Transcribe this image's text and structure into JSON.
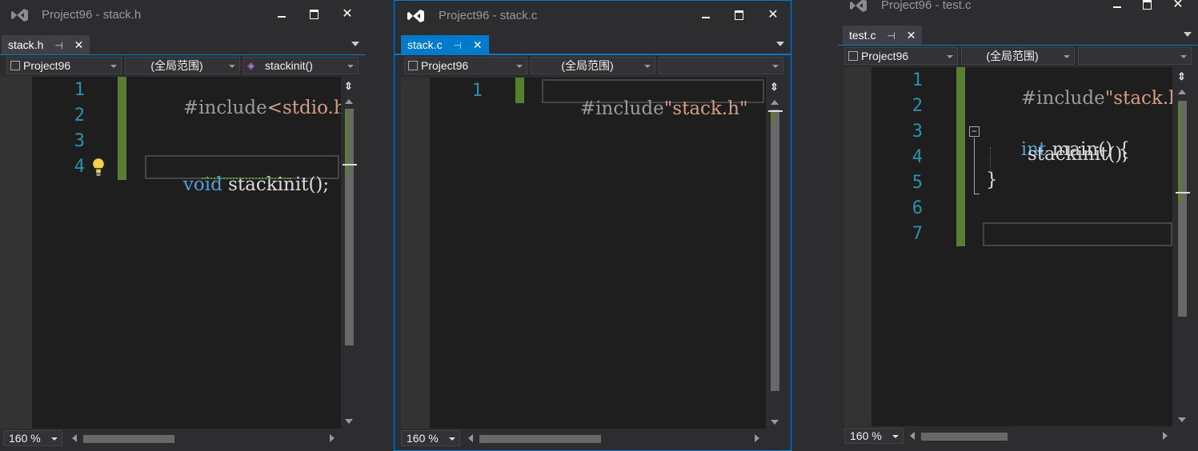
{
  "windows": [
    {
      "title": "Project96 - stack.h",
      "tab": {
        "label": "stack.h"
      },
      "nav": {
        "project": "Project96",
        "scope": "(全局范围)",
        "member": "stackinit()"
      },
      "lines": [
        "1",
        "2",
        "3",
        "4"
      ],
      "code": {
        "l1_directive": "#include",
        "l1_arg": "<stdio.h>",
        "l4_kw": "void",
        "l4_rest": " stackinit();"
      },
      "zoom": "160 %"
    },
    {
      "title": "Project96 - stack.c",
      "tab": {
        "label": "stack.c"
      },
      "nav": {
        "project": "Project96",
        "scope": "(全局范围)",
        "member": ""
      },
      "lines": [
        "1"
      ],
      "code": {
        "l1_directive": "#include",
        "l1_arg": "\"stack.h\""
      },
      "zoom": "160 %"
    },
    {
      "title": "Project96 - test.c",
      "tab": {
        "label": "test.c"
      },
      "nav": {
        "project": "Project96",
        "scope": "(全局范围)",
        "member": ""
      },
      "lines": [
        "1",
        "2",
        "3",
        "4",
        "5",
        "6",
        "7"
      ],
      "code": {
        "l1_directive": "#include",
        "l1_arg": "\"stack.h\"",
        "l3_kw": "int",
        "l3_rest": " main() {",
        "l4": "stackinit();",
        "l5": "}"
      },
      "zoom": "160 %"
    }
  ],
  "colors": {
    "accent": "#007acc",
    "change_bar": "#577f2e",
    "line_number": "#2b91af",
    "keyword": "#569cd6",
    "string": "#d69d85"
  }
}
